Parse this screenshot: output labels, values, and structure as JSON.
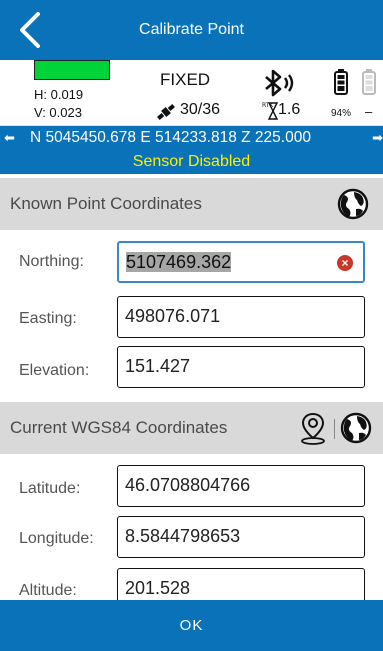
{
  "header": {
    "title": "Calibrate Point"
  },
  "status": {
    "h_accuracy": "H: 0.019",
    "v_accuracy": "V: 0.023",
    "fix_type": "FIXED",
    "satellites": "30/36",
    "correction_age": "1.6",
    "rtk_label": "RTK",
    "battery1_percent": "94%",
    "battery2_percent": "–",
    "quality_color": "#00d33a"
  },
  "coord_bar": {
    "text": "N 5045450.678 E 514233.818 Z 225.000",
    "left_arrow": "⬅",
    "right_arrow": "➡"
  },
  "sensor_status": "Sensor Disabled",
  "known_point": {
    "title": "Known Point Coordinates",
    "northing_label": "Northing:",
    "northing_value": "5107469.362",
    "easting_label": "Easting:",
    "easting_value": "498076.071",
    "elevation_label": "Elevation:",
    "elevation_value": "151.427"
  },
  "current": {
    "title": "Current WGS84 Coordinates",
    "latitude_label": "Latitude:",
    "latitude_value": "46.0708804766",
    "longitude_label": "Longitude:",
    "longitude_value": "8.5844798653",
    "altitude_label": "Altitude:",
    "altitude_value": "201.528"
  },
  "ok_label": "OK"
}
